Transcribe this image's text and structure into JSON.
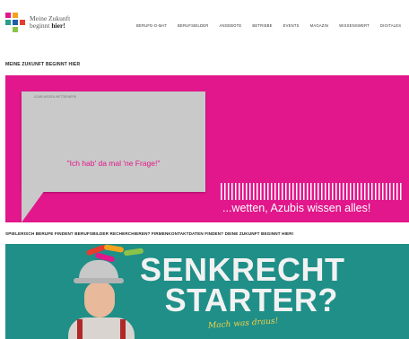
{
  "logo": {
    "line1": "Meine Zukunft",
    "line2_plain": "beginnt ",
    "line2_bold": "hier!"
  },
  "nav": [
    "Berufe-o-mat",
    "Berufsbilder",
    "Angebote",
    "Betriebe",
    "Events",
    "Magazin",
    "Wissenswert",
    "Digitales"
  ],
  "section_title": "MEINE ZUKUNFT BEGINNT HIER",
  "hero1": {
    "bubble_label": "Azubi-Wissen-Wettbewerb",
    "bubble_text": "\"Ich hab' da mal 'ne Frage!\"",
    "banner_text": "...wetten, Azubis wissen alles!"
  },
  "subline": "SPIELERISCH BERUFE FINDEN? BERUFSBILDER RECHERCHIEREN? FIRMENKONTAKTDATEN FINDEN? DEINE ZUKUNFT BEGINNT HIER!",
  "hero2": {
    "headline_1": "SENKRECHT",
    "headline_2": "STARTER?",
    "tagline": "Mach was draus!"
  },
  "colors": {
    "magenta": "#e1178b",
    "teal": "#1f8f88",
    "yellow": "#f5d24a"
  }
}
